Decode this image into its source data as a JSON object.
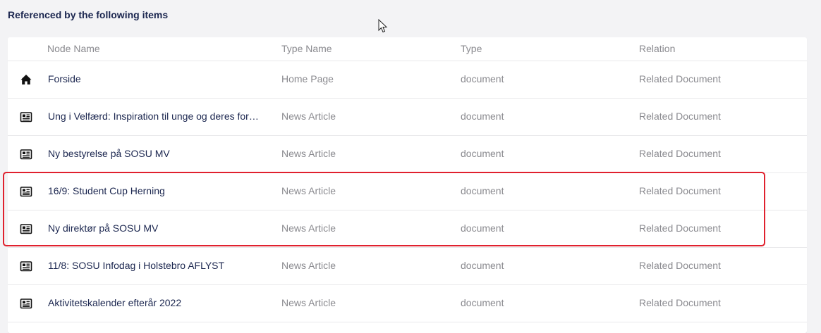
{
  "section": {
    "title": "Referenced by the following items"
  },
  "table": {
    "headers": {
      "node_name": "Node Name",
      "type_name": "Type Name",
      "type": "Type",
      "relation": "Relation"
    },
    "rows": [
      {
        "icon": "home-icon",
        "node_name": "Forside",
        "type_name": "Home Page",
        "type": "document",
        "relation": "Related Document"
      },
      {
        "icon": "newspaper-icon",
        "node_name": "Ung i Velfærd: Inspiration til unge og deres for…",
        "type_name": "News Article",
        "type": "document",
        "relation": "Related Document"
      },
      {
        "icon": "newspaper-icon",
        "node_name": "Ny bestyrelse på SOSU MV",
        "type_name": "News Article",
        "type": "document",
        "relation": "Related Document"
      },
      {
        "icon": "newspaper-icon",
        "node_name": "16/9: Student Cup Herning",
        "type_name": "News Article",
        "type": "document",
        "relation": "Related Document"
      },
      {
        "icon": "newspaper-icon",
        "node_name": "Ny direktør på SOSU MV",
        "type_name": "News Article",
        "type": "document",
        "relation": "Related Document"
      },
      {
        "icon": "newspaper-icon",
        "node_name": "11/8: SOSU Infodag i Holstebro AFLYST",
        "type_name": "News Article",
        "type": "document",
        "relation": "Related Document"
      },
      {
        "icon": "newspaper-icon",
        "node_name": "Aktivitetskalender efterår 2022",
        "type_name": "News Article",
        "type": "document",
        "relation": "Related Document"
      }
    ]
  },
  "colors": {
    "highlight": "#e0212e",
    "name_text": "#1b264f",
    "muted_text": "#8a8a8f"
  }
}
